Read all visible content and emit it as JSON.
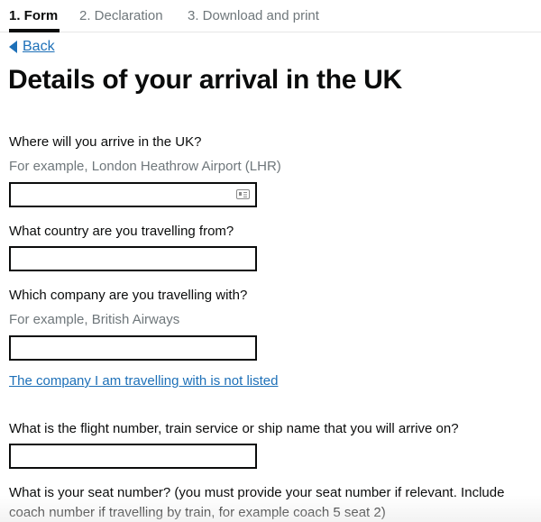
{
  "tabs": [
    {
      "label": "1. Form",
      "active": true
    },
    {
      "label": "2. Declaration",
      "active": false
    },
    {
      "label": "3. Download and print",
      "active": false
    }
  ],
  "back_link": {
    "label": "Back",
    "icon": "triangle-left-icon"
  },
  "page_title": "Details of your arrival in the UK",
  "fields": [
    {
      "label": "Where will you arrive in the UK?",
      "hint": "For example, London Heathrow Airport (LHR)",
      "value": "",
      "icon": "contact-card-icon"
    },
    {
      "label": "What country are you travelling from?",
      "value": ""
    },
    {
      "label": "Which company are you travelling with?",
      "hint": "For example, British Airways",
      "value": ""
    },
    {
      "label": "What is the flight number, train service or ship name that you will arrive on?",
      "value": ""
    },
    {
      "label_line1": "What is your seat number? (you must provide your seat number if relevant. Include",
      "label_line2": "coach number if travelling by train, for example coach 5 seat 2)"
    }
  ],
  "company_not_listed_link": "The company I am travelling with is not listed",
  "colors": {
    "link": "#1d70b8",
    "text": "#0b0c0c",
    "hint": "#6f777b"
  }
}
